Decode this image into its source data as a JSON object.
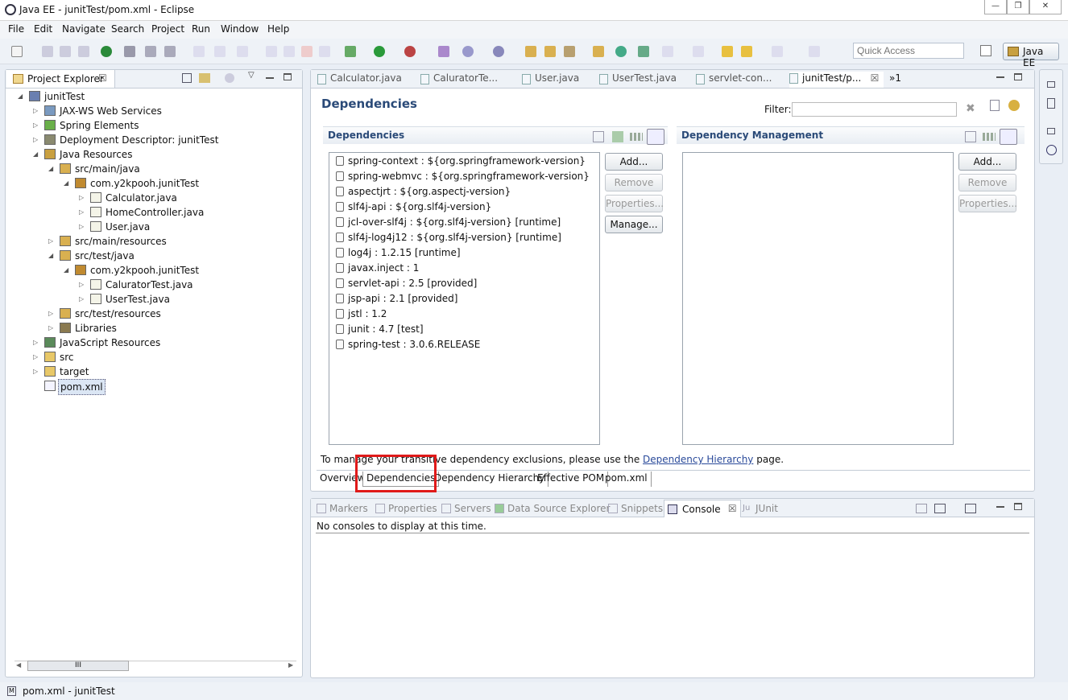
{
  "window": {
    "title": "Java EE - junitTest/pom.xml - Eclipse",
    "minimize": "—",
    "maximize": "❐",
    "close": "✕"
  },
  "menu": [
    "File",
    "Edit",
    "Navigate",
    "Search",
    "Project",
    "Run",
    "Window",
    "Help"
  ],
  "toolbar": {
    "quick_access_placeholder": "Quick Access",
    "perspective": "Java EE"
  },
  "project_explorer": {
    "tab_label": "Project Explorer",
    "tree": [
      {
        "label": "junitTest",
        "icon": "project-icon",
        "twisty": "expanded"
      },
      {
        "label": "JAX-WS Web Services",
        "icon": "webservices-icon",
        "twisty": "collapsed"
      },
      {
        "label": "Spring Elements",
        "icon": "spring-icon",
        "twisty": "collapsed"
      },
      {
        "label": "Deployment Descriptor: junitTest",
        "icon": "descriptor-icon",
        "twisty": "collapsed"
      },
      {
        "label": "Java Resources",
        "icon": "java-resources-icon",
        "twisty": "expanded"
      },
      {
        "label": "src/main/java",
        "icon": "source-folder-icon",
        "twisty": "expanded"
      },
      {
        "label": "com.y2kpooh.junitTest",
        "icon": "package-icon",
        "twisty": "expanded"
      },
      {
        "label": "Calculator.java",
        "icon": "java-file-icon",
        "twisty": "collapsed"
      },
      {
        "label": "HomeController.java",
        "icon": "java-file-icon",
        "twisty": "collapsed"
      },
      {
        "label": "User.java",
        "icon": "java-file-icon",
        "twisty": "collapsed"
      },
      {
        "label": "src/main/resources",
        "icon": "source-folder-icon",
        "twisty": "collapsed"
      },
      {
        "label": "src/test/java",
        "icon": "source-folder-icon",
        "twisty": "expanded"
      },
      {
        "label": "com.y2kpooh.junitTest",
        "icon": "package-icon",
        "twisty": "expanded"
      },
      {
        "label": "CaluratorTest.java",
        "icon": "java-file-icon",
        "twisty": "collapsed"
      },
      {
        "label": "UserTest.java",
        "icon": "java-file-icon",
        "twisty": "collapsed"
      },
      {
        "label": "src/test/resources",
        "icon": "source-folder-icon",
        "twisty": "collapsed"
      },
      {
        "label": "Libraries",
        "icon": "libraries-icon",
        "twisty": "collapsed"
      },
      {
        "label": "JavaScript Resources",
        "icon": "js-resources-icon",
        "twisty": "collapsed"
      },
      {
        "label": "src",
        "icon": "folder-icon",
        "twisty": "collapsed"
      },
      {
        "label": "target",
        "icon": "folder-icon",
        "twisty": "collapsed"
      },
      {
        "label": "pom.xml",
        "icon": "pom-file-icon",
        "twisty": "none"
      }
    ],
    "scroll_thumb": "III"
  },
  "editor_tabs": [
    {
      "label": "Calculator.java"
    },
    {
      "label": "CaluratorTe..."
    },
    {
      "label": "User.java"
    },
    {
      "label": "UserTest.java"
    },
    {
      "label": "servlet-con..."
    },
    {
      "label": "junitTest/p..."
    }
  ],
  "editor_tabs_overflow": "»1",
  "pom_editor": {
    "title": "Dependencies",
    "filter_label": "Filter:",
    "dependencies_section": "Dependencies",
    "dependencies": [
      "spring-context : ${org.springframework-version}",
      "spring-webmvc : ${org.springframework-version}",
      "aspectjrt : ${org.aspectj-version}",
      "slf4j-api : ${org.slf4j-version}",
      "jcl-over-slf4j : ${org.slf4j-version} [runtime]",
      "slf4j-log4j12 : ${org.slf4j-version} [runtime]",
      "log4j : 1.2.15 [runtime]",
      "javax.inject : 1",
      "servlet-api : 2.5 [provided]",
      "jsp-api : 2.1 [provided]",
      "jstl : 1.2",
      "junit : 4.7 [test]",
      "spring-test : 3.0.6.RELEASE"
    ],
    "dep_buttons": {
      "add": "Add...",
      "remove": "Remove",
      "properties": "Properties...",
      "manage": "Manage..."
    },
    "management_section": "Dependency Management",
    "mgmt_buttons": {
      "add": "Add...",
      "remove": "Remove",
      "properties": "Properties..."
    },
    "info_prefix": "To manage your transitive dependency exclusions, please use the",
    "info_link": "Dependency Hierarchy",
    "info_suffix": "page.",
    "page_tabs": [
      "Overview",
      "Dependencies",
      "Dependency Hierarchy",
      "Effective POM",
      "pom.xml"
    ]
  },
  "console_panel": {
    "tabs": [
      "Markers",
      "Properties",
      "Servers",
      "Data Source Explorer",
      "Snippets",
      "Console",
      "JUnit"
    ],
    "message": "No consoles to display at this time."
  },
  "status_bar": {
    "icon_text": "M",
    "text": "pom.xml - junitTest"
  },
  "colors": {
    "highlight": "#e01a1a",
    "section_title": "#2a4a78",
    "link": "#2a4a9a"
  }
}
